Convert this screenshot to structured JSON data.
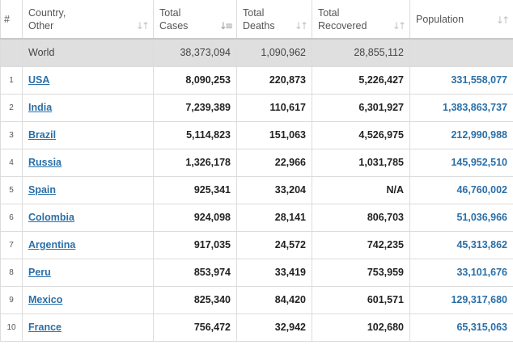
{
  "headers": {
    "rank": "#",
    "country": [
      "Country,",
      "Other"
    ],
    "cases": [
      "Total",
      "Cases"
    ],
    "deaths": [
      "Total",
      "Deaths"
    ],
    "recovered": [
      "Total",
      "Recovered"
    ],
    "population": "Population",
    "sort_icon": "sort-arrows-icon",
    "sort_active_icon": "sort-descending-icon"
  },
  "world": {
    "label": "World",
    "cases": "38,373,094",
    "deaths": "1,090,962",
    "recovered": "28,855,112",
    "population": ""
  },
  "rows": [
    {
      "rank": "1",
      "country": "USA",
      "cases": "8,090,253",
      "deaths": "220,873",
      "recovered": "5,226,427",
      "population": "331,558,077"
    },
    {
      "rank": "2",
      "country": "India",
      "cases": "7,239,389",
      "deaths": "110,617",
      "recovered": "6,301,927",
      "population": "1,383,863,737"
    },
    {
      "rank": "3",
      "country": "Brazil",
      "cases": "5,114,823",
      "deaths": "151,063",
      "recovered": "4,526,975",
      "population": "212,990,988"
    },
    {
      "rank": "4",
      "country": "Russia",
      "cases": "1,326,178",
      "deaths": "22,966",
      "recovered": "1,031,785",
      "population": "145,952,510"
    },
    {
      "rank": "5",
      "country": "Spain",
      "cases": "925,341",
      "deaths": "33,204",
      "recovered": "N/A",
      "population": "46,760,002"
    },
    {
      "rank": "6",
      "country": "Colombia",
      "cases": "924,098",
      "deaths": "28,141",
      "recovered": "806,703",
      "population": "51,036,966"
    },
    {
      "rank": "7",
      "country": "Argentina",
      "cases": "917,035",
      "deaths": "24,572",
      "recovered": "742,235",
      "population": "45,313,862"
    },
    {
      "rank": "8",
      "country": "Peru",
      "cases": "853,974",
      "deaths": "33,419",
      "recovered": "753,959",
      "population": "33,101,676"
    },
    {
      "rank": "9",
      "country": "Mexico",
      "cases": "825,340",
      "deaths": "84,420",
      "recovered": "601,571",
      "population": "129,317,680"
    },
    {
      "rank": "10",
      "country": "France",
      "cases": "756,472",
      "deaths": "32,942",
      "recovered": "102,680",
      "population": "65,315,063"
    }
  ],
  "colors": {
    "link": "#2a6fa8",
    "world_row_bg": "#dfdfdf",
    "border": "#dcdcdc"
  }
}
